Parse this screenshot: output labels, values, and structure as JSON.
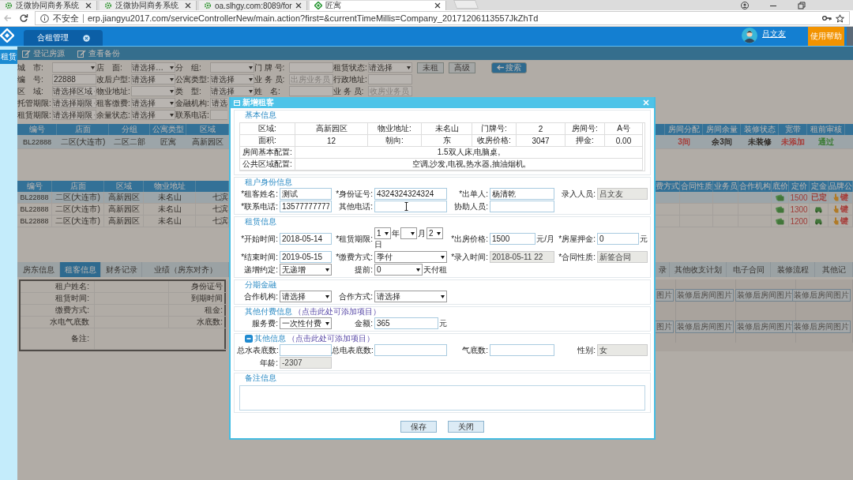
{
  "browser": {
    "tabs": [
      {
        "title": "泛微协同商务系统",
        "selected": false
      },
      {
        "title": "泛微协同商务系统",
        "selected": false
      },
      {
        "title": "oa.slhgy.com:8089/for",
        "selected": false
      },
      {
        "title": "匠寓",
        "selected": true
      }
    ],
    "security": "不安全",
    "url": "erp.jiangyu2017.com/serviceControllerNew/main.action?first=&currentTimeMillis=Company_20171206113557JkZhTd"
  },
  "header": {
    "tabs": [
      {
        "label": "合租管理",
        "selected": true
      }
    ],
    "user": "吕文友",
    "help": "使用帮助"
  },
  "sidebar": {
    "items": [
      {
        "label": "租赁",
        "selected": true
      }
    ]
  },
  "toolbar": [
    "登记房源",
    "查看备份"
  ],
  "filters": {
    "rows": [
      [
        {
          "label": "城　市:",
          "kind": "select"
        },
        {
          "label": "店　面:",
          "kind": "select",
          "value": "请选择…"
        },
        {
          "label": "分　组:",
          "kind": "select"
        },
        {
          "label": "门 牌 号:",
          "kind": "text"
        },
        {
          "label": "租赁状态:",
          "kind": "select",
          "value": "请选择"
        }
      ],
      [
        {
          "label": "编　号:",
          "kind": "text",
          "value": "22888"
        },
        {
          "label": "改后户型:",
          "kind": "select",
          "value": "请选择"
        },
        {
          "label": "公寓类型:",
          "kind": "select",
          "value": "请选择"
        },
        {
          "label": "业 务 员:",
          "kind": "text",
          "placeholder": "出房业务员"
        },
        {
          "label": "行政地址:",
          "kind": "text"
        }
      ],
      [
        {
          "label": "区　域:",
          "kind": "select",
          "value": "请选择区域"
        },
        {
          "label": "物业地址:",
          "kind": "select"
        },
        {
          "label": "类　型:",
          "kind": "select",
          "value": "请选择"
        },
        {
          "label": "姓　名:",
          "kind": "text"
        },
        {
          "label": "业 务 员:",
          "kind": "text",
          "placeholder": "收房业务员"
        }
      ],
      [
        {
          "label": "托管期限:",
          "kind": "select",
          "value": "请选择期限"
        },
        {
          "label": "租客缴费:",
          "kind": "select",
          "value": "请选择"
        },
        {
          "label": "金融机构:",
          "kind": "cut",
          "value": "请选"
        }
      ],
      [
        {
          "label": "租赁期限:",
          "kind": "select",
          "value": "请选择期限"
        },
        {
          "label": "余量状态:",
          "kind": "select",
          "value": "请选择"
        },
        {
          "label": "联系电话:",
          "kind": "cut"
        }
      ]
    ],
    "buttons": [
      {
        "label": "未租",
        "kind": "plain"
      },
      {
        "label": "高级",
        "kind": "plain"
      },
      {
        "label": "搜索",
        "kind": "search"
      }
    ]
  },
  "table_top": {
    "columns_left": [
      "编号",
      "店面",
      "分组",
      "公寓类型",
      "区域"
    ],
    "columns_right": [
      "房间分配",
      "房间余量",
      "装修状态",
      "宽带",
      "租前审核"
    ],
    "rows": [
      {
        "left": [
          "BL22888",
          "二区(大连市)",
          "二区二部",
          "匠寓",
          "高新园区"
        ],
        "right": [
          {
            "text": "3间",
            "color": "#a63b37"
          },
          {
            "text": "余3间",
            "color": "#302c28"
          },
          {
            "text": "未装修",
            "color": "#302c28"
          },
          {
            "text": "未添加",
            "color": "#a63b37"
          },
          {
            "text": "通过",
            "color": "#387a30"
          }
        ]
      }
    ]
  },
  "table_rooms": {
    "columns_left": [
      "编号",
      "店面",
      "区域",
      "物业地址"
    ],
    "columns_right": [
      "费方式",
      "合同性质",
      "业务员",
      "合作机构",
      "底价",
      "定价",
      "定金",
      "品牌公"
    ],
    "rows": [
      {
        "selected": true,
        "left": [
          "BL22888",
          "二区(大连市)",
          "高新园区",
          "未名山",
          "七滨"
        ],
        "price": "1500",
        "deposit": {
          "kind": "text",
          "text": "已定"
        },
        "brand": "键"
      },
      {
        "selected": false,
        "left": [
          "BL22888",
          "二区(大连市)",
          "高新园区",
          "未名山",
          "七滨"
        ],
        "price": "1300",
        "deposit": {
          "kind": "icon"
        },
        "brand": "键"
      },
      {
        "selected": false,
        "left": [
          "BL22888",
          "二区(大连市)",
          "高新园区",
          "未名山",
          "七滨"
        ],
        "price": "1200",
        "deposit": {
          "kind": "icon"
        },
        "brand": "键"
      }
    ]
  },
  "detail_tabs": {
    "left": [
      {
        "label": "房东信息",
        "selected": false
      },
      {
        "label": "租客信息",
        "selected": true
      },
      {
        "label": "财务记录",
        "selected": false
      },
      {
        "label": "业绩（房东对齐）",
        "selected": false
      }
    ],
    "right": [
      {
        "label": "录",
        "selected": false
      },
      {
        "label": "其他收支计划",
        "selected": false
      },
      {
        "label": "电子合同",
        "selected": false
      },
      {
        "label": "装修流程",
        "selected": false
      },
      {
        "label": "其他记",
        "selected": false
      }
    ]
  },
  "tenant_details": [
    [
      "租户姓名:",
      "身份证号"
    ],
    [
      "租赁时间:",
      "到期时间"
    ],
    [
      "缴费方式:",
      "租金:"
    ],
    [
      "水电气底数",
      "水底数:"
    ],
    [
      "备注:"
    ]
  ],
  "photo_buttons": [
    [
      "图片",
      "装修后房间图片",
      "装修后房间图片",
      "装修后房间图片"
    ],
    [
      "图片",
      "装修后房间图片",
      "装修后房间图片",
      "装修后房间图片"
    ]
  ],
  "modal": {
    "title": "新增租客",
    "sections": [
      {
        "kind": "table",
        "legend": "基本信息",
        "rows": [
          [
            "区域:",
            "高新园区",
            "物业地址:",
            "未名山",
            "门牌号:",
            "2",
            "房间号:",
            "A号"
          ],
          [
            "面积:",
            "12",
            "朝向:",
            "东",
            "收房价格:",
            "3047",
            "押金:",
            "0.00"
          ],
          [
            "房间基本配置:",
            "1.5双人床,电脑桌,"
          ],
          [
            "公共区域配置:",
            "空调,沙发,电视,热水器,抽油烟机,"
          ]
        ]
      },
      {
        "kind": "form",
        "legend": "租户身份信息",
        "rows": [
          [
            {
              "label": "*租客姓名:",
              "kind": "text",
              "value": "测试"
            },
            {
              "label": "*身份证号:",
              "kind": "text",
              "value": "4324324324324"
            },
            {
              "label": "*出单人:",
              "kind": "text",
              "value": "杨清乾"
            },
            {
              "label": "录入人员:",
              "kind": "text",
              "value": "吕文友",
              "disabled": true
            }
          ],
          [
            {
              "label": "*联系电话:",
              "kind": "text",
              "value": "13577777777"
            },
            {
              "label": "其他电话:",
              "kind": "text",
              "hovered": true
            },
            {
              "label": "协助人员:",
              "kind": "text"
            }
          ]
        ]
      },
      {
        "kind": "form",
        "legend": "租赁信息",
        "rows": [
          [
            {
              "label": "*开始时间:",
              "kind": "text",
              "value": "2018-05-14"
            },
            {
              "label": "*租赁期限:",
              "kind": "period",
              "parts": [
                {
                  "value": "1",
                  "unit": "年"
                },
                {
                  "unit": "月"
                },
                {
                  "value": "2",
                  "unit": "日"
                }
              ]
            },
            {
              "label": "*出房价格:",
              "kind": "text",
              "value": "1500",
              "unit": "元/月"
            },
            {
              "label": "*房屋押金:",
              "kind": "text",
              "value": "0",
              "unit": "元"
            }
          ],
          [
            {
              "label": "*结束时间:",
              "kind": "text",
              "value": "2019-05-15"
            },
            {
              "label": "*缴费方式:",
              "kind": "select",
              "value": "季付"
            },
            {
              "label": "*录入时间:",
              "kind": "text",
              "value": "2018-05-11 22",
              "disabled": true
            },
            {
              "label": "*合同性质:",
              "kind": "text",
              "value": "新签合同",
              "disabled": true
            }
          ],
          [
            {
              "label": "递增约定:",
              "kind": "select",
              "value": "无递增"
            },
            {
              "label": "提前:",
              "kind": "select",
              "value": "0",
              "unit": "天付租"
            }
          ]
        ]
      },
      {
        "kind": "form",
        "legend": "分期金融",
        "rows": [
          [
            {
              "label": "合作机构:",
              "kind": "select",
              "value": "请选择"
            },
            {
              "label": "合作方式:",
              "kind": "select",
              "value": "请选择"
            }
          ]
        ]
      },
      {
        "kind": "form",
        "legend": "其他付费信息",
        "hint": "（点击此处可添加项目）",
        "rows": [
          [
            {
              "label": "服务费:",
              "kind": "select",
              "value": "一次性付费"
            },
            {
              "label": "金额:",
              "kind": "text",
              "value": "365",
              "unit": "元"
            }
          ]
        ]
      },
      {
        "kind": "form",
        "legend": "其他信息",
        "hint": "（点击此处可添加项目）",
        "expanded": true,
        "rows": [
          [
            {
              "label": "总水表底数:",
              "kind": "text"
            },
            {
              "label": "总电表底数:",
              "kind": "text"
            },
            {
              "label": "气底数:",
              "kind": "text"
            },
            {
              "label": "性别:",
              "kind": "text",
              "value": "女",
              "disabled": true
            }
          ],
          [
            {
              "label": "年龄:",
              "kind": "text",
              "value": "-2307",
              "disabled": true
            }
          ]
        ]
      },
      {
        "kind": "notes",
        "legend": "备注信息"
      }
    ],
    "buttons": [
      "保存",
      "关闭"
    ]
  }
}
